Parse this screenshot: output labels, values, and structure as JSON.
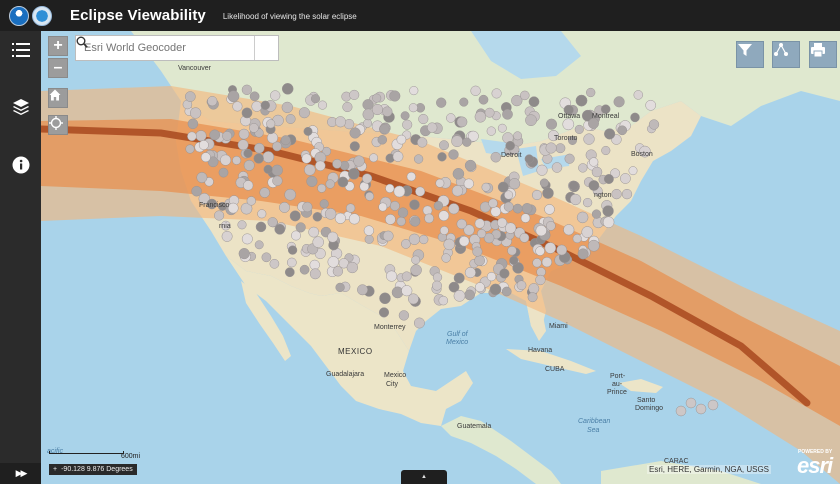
{
  "header": {
    "title": "Eclipse Viewability",
    "subtitle": "Likelihood of viewing the solar eclipse"
  },
  "search": {
    "placeholder": "Esri World Geocoder"
  },
  "zoom": {
    "in": "+",
    "out": "–"
  },
  "map_labels": [
    {
      "text": "Vancouver"
    },
    {
      "text": "Ottawa"
    },
    {
      "text": "Montreal"
    },
    {
      "text": "Toronto"
    },
    {
      "text": "Boston"
    },
    {
      "text": "Detroit"
    },
    {
      "text": "ngton"
    },
    {
      "text": "Francisco"
    },
    {
      "text": "Monterrey"
    },
    {
      "text": "MEXICO"
    },
    {
      "text": "Guadalajara"
    },
    {
      "text": "Mexico"
    },
    {
      "text": "City"
    },
    {
      "text": "Guatemala"
    },
    {
      "text": "Havana"
    },
    {
      "text": "CUBA"
    },
    {
      "text": "Miami"
    },
    {
      "text": "Port-"
    },
    {
      "text": "au-"
    },
    {
      "text": "Prince"
    },
    {
      "text": "Santo"
    },
    {
      "text": "Domingo"
    },
    {
      "text": "Caribbean"
    },
    {
      "text": "Sea"
    },
    {
      "text": "Gulf of"
    },
    {
      "text": "Mexico"
    },
    {
      "text": "CARAC"
    },
    {
      "text": "rnia"
    },
    {
      "text": "acific"
    }
  ],
  "scale": {
    "label": "600mi"
  },
  "coords": {
    "plus": "+",
    "text": "-90.128 9.876 Degrees"
  },
  "attribution": "Esri, HERE, Garmin, NGA, USGS",
  "esri": {
    "powered": "POWERED BY",
    "word": "esri"
  },
  "colors": {
    "header_bg": "#1f1f1f",
    "sidebar_bg": "#2b2b2b",
    "path_outer": "#f3b77a",
    "path_mid": "#e78f4e",
    "path_center": "#a8491e",
    "ocean": "#a9d3ea",
    "land": "#e8e0c5",
    "point": "#d3cccc",
    "button_accent": "#8fa9bd"
  },
  "icons": [
    "list-icon",
    "layers-icon",
    "info-icon",
    "home-icon",
    "locate-icon",
    "search-icon",
    "filter-icon",
    "share-icon",
    "print-icon",
    "expand-icon",
    "chevron-up-icon"
  ]
}
